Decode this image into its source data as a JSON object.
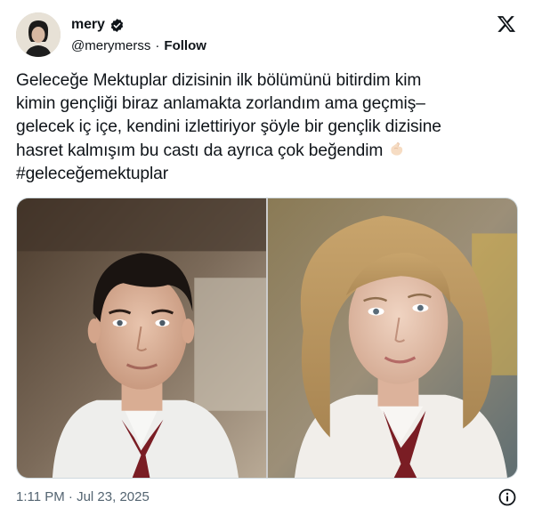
{
  "user": {
    "display_name": "mery",
    "handle": "@merymerss",
    "separator": "·",
    "follow_label": "Follow"
  },
  "tweet": {
    "lines": [
      "Geleceğe Mektuplar dizisinin ilk bölümünü bitirdim kim",
      "kimin gençliği biraz anlamakta zorlandım ama geçmiş–",
      "gelecek iç içe, kendini izlettiriyor şöyle bir gençlik dizisine",
      "hasret kalmışım bu castı da ayrıca çok beğendim",
      "#geleceğemektuplar"
    ],
    "emoji": "pinching-hand-emoji"
  },
  "meta": {
    "timestamp": "1:11 PM · Jul 23, 2025"
  },
  "icons": {
    "verified": "verified-badge-icon",
    "brand": "x-logo-icon",
    "info": "info-icon"
  },
  "colors": {
    "text": "#0f1419",
    "muted": "#536471",
    "tie": "#7a1d24"
  }
}
